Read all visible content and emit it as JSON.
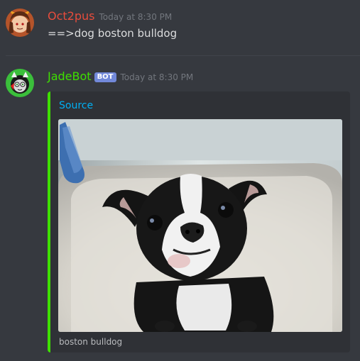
{
  "messages": [
    {
      "author": "Oct2pus",
      "timestamp": "Today at 8:30 PM",
      "content": "==>dog boston bulldog",
      "author_color": "#e74c3c"
    },
    {
      "author": "JadeBot",
      "bot_tag": "BOT",
      "timestamp": "Today at 8:30 PM",
      "author_color": "#3ee000",
      "embed": {
        "title": "Source",
        "image": "boston-bulldog-photo",
        "footer": "boston bulldog",
        "accent_color": "#3ee000"
      }
    }
  ],
  "colors": {
    "background": "#36393f",
    "embed_background": "#2f3136",
    "link": "#00b0f4",
    "bot_tag": "#7289da"
  }
}
